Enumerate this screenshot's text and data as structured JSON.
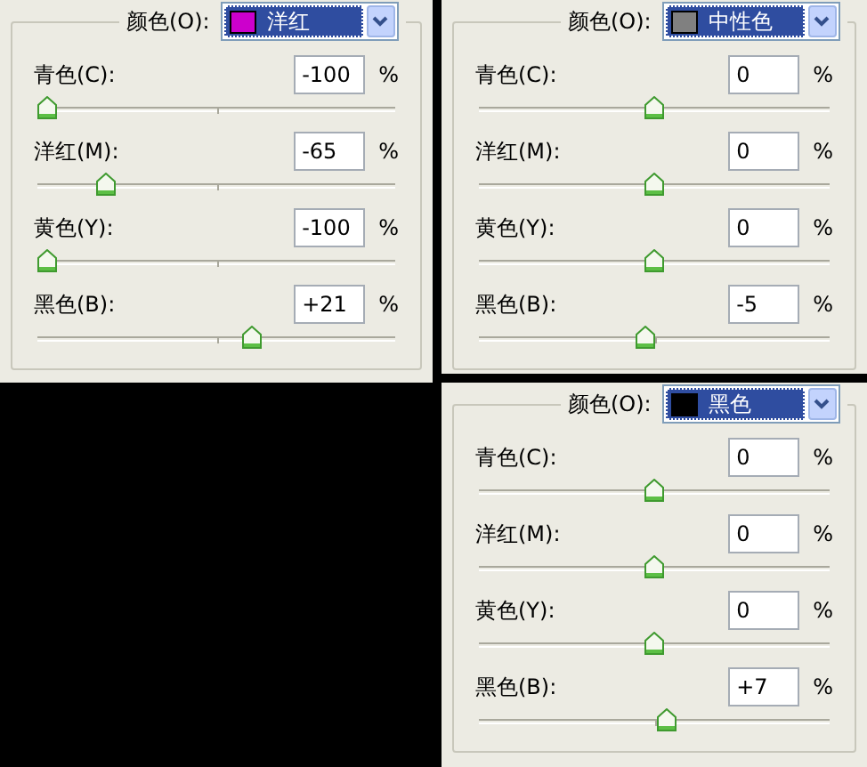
{
  "panels": [
    {
      "color_select": {
        "label": "颜色(O):",
        "value": "洋红",
        "color": "#cc00cc"
      },
      "channels": [
        {
          "name": "青色(C):",
          "value": "-100",
          "unit": "%",
          "level": 0
        },
        {
          "name": "洋红(M):",
          "value": "-65",
          "unit": "%",
          "level": 0.175
        },
        {
          "name": "黄色(Y):",
          "value": "-100",
          "unit": "%",
          "level": 0
        },
        {
          "name": "黑色(B):",
          "value": "+21",
          "unit": "%",
          "level": 0.605
        }
      ]
    },
    {
      "color_select": {
        "label": "颜色(O):",
        "value": "中性色",
        "color": "#808080"
      },
      "channels": [
        {
          "name": "青色(C):",
          "value": "0",
          "unit": "%",
          "level": 0.5
        },
        {
          "name": "洋红(M):",
          "value": "0",
          "unit": "%",
          "level": 0.5
        },
        {
          "name": "黄色(Y):",
          "value": "0",
          "unit": "%",
          "level": 0.5
        },
        {
          "name": "黑色(B):",
          "value": "-5",
          "unit": "%",
          "level": 0.475
        }
      ]
    },
    {
      "color_select": {
        "label": "颜色(O):",
        "value": "黑色",
        "color": "#000000"
      },
      "channels": [
        {
          "name": "青色(C):",
          "value": "0",
          "unit": "%",
          "level": 0.5
        },
        {
          "name": "洋红(M):",
          "value": "0",
          "unit": "%",
          "level": 0.5
        },
        {
          "name": "黄色(Y):",
          "value": "0",
          "unit": "%",
          "level": 0.5
        },
        {
          "name": "黑色(B):",
          "value": "+7",
          "unit": "%",
          "level": 0.535
        }
      ]
    }
  ]
}
